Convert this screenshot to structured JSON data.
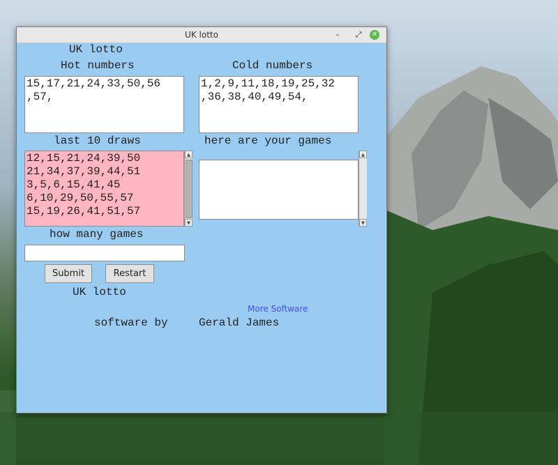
{
  "window": {
    "title": "UK lotto",
    "controls": {
      "minimize": "–",
      "maximize": "⤢",
      "close": "✕"
    }
  },
  "app": {
    "heading_top": "UK lotto",
    "hot_label": "Hot numbers",
    "hot_lines": [
      "15,17,21,24,33,50,56",
      ",57,"
    ],
    "cold_label": "Cold numbers",
    "cold_lines": [
      "1,2,9,11,18,19,25,32",
      ",36,38,40,49,54,"
    ],
    "last_draws_label": "last 10 draws",
    "last_draws": [
      "12,15,21,24,39,50",
      "21,34,37,39,44,51",
      "3,5,6,15,41,45",
      "6,10,29,50,55,57",
      "15,19,26,41,51,57"
    ],
    "games_label": "here are your games",
    "how_many_label": "how many games",
    "how_many_value": "",
    "submit_label": "Submit",
    "restart_label": "Restart",
    "heading_bottom": "UK lotto",
    "more_software": "More Software",
    "credit_prefix": "software by",
    "credit_name": "Gerald James"
  },
  "colors": {
    "window_bg": "#99ccf0",
    "list_bg": "#ffb6c2",
    "link": "#4a4aff",
    "close_button": "#5aba4a"
  },
  "icons": {
    "scroll_up": "triangle-up",
    "scroll_down": "triangle-down"
  }
}
